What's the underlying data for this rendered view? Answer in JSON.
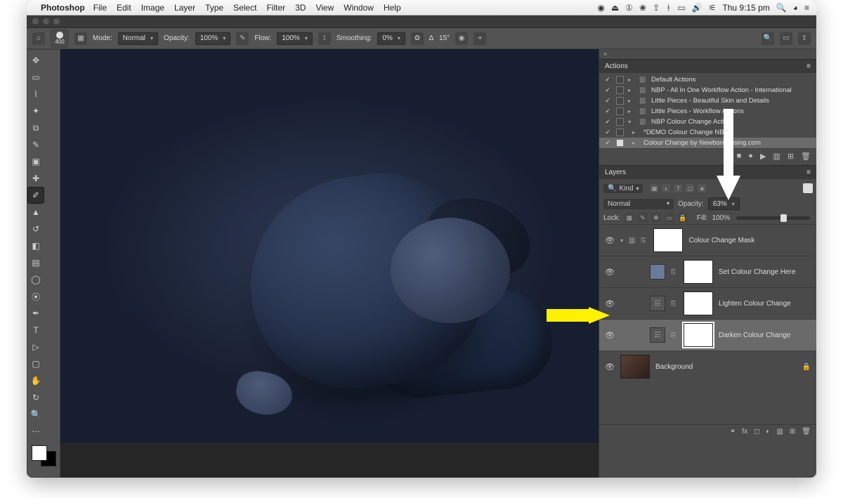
{
  "menubar": {
    "app": "Photoshop",
    "items": [
      "File",
      "Edit",
      "Image",
      "Layer",
      "Type",
      "Select",
      "Filter",
      "3D",
      "View",
      "Window",
      "Help"
    ],
    "clock": "Thu 9:15 pm"
  },
  "options": {
    "brush_size": "400",
    "mode_label": "Mode:",
    "mode_value": "Normal",
    "opacity_label": "Opacity:",
    "opacity_value": "100%",
    "flow_label": "Flow:",
    "flow_value": "100%",
    "smoothing_label": "Smoothing:",
    "smoothing_value": "0%",
    "angle_label": "∆",
    "angle_value": "15°"
  },
  "actions": {
    "title": "Actions",
    "items": [
      {
        "level": 0,
        "checked": true,
        "folder": true,
        "open": false,
        "label": "Default Actions"
      },
      {
        "level": 0,
        "checked": true,
        "folder": true,
        "open": false,
        "label": "NBP - All In One Workflow Action - International"
      },
      {
        "level": 0,
        "checked": true,
        "folder": true,
        "open": false,
        "label": "Little Pieces - Beautiful Skin and Details"
      },
      {
        "level": 0,
        "checked": true,
        "folder": true,
        "open": false,
        "label": "Little Pieces - Workflow Actions"
      },
      {
        "level": 0,
        "checked": true,
        "folder": true,
        "open": true,
        "label": "NBP Colour Change Action"
      },
      {
        "level": 1,
        "checked": true,
        "folder": false,
        "open": false,
        "label": "*DEMO Colour Change NBP"
      },
      {
        "level": 1,
        "checked": true,
        "folder": false,
        "open": false,
        "label": "Colour Change by NewbornPosing.com",
        "selected": true
      }
    ],
    "footer_icons": [
      "stop",
      "rec",
      "play",
      "folder",
      "new",
      "trash"
    ]
  },
  "layers": {
    "title": "Layers",
    "kind_label": "Kind",
    "blend_mode": "Normal",
    "opacity_label": "Opacity:",
    "opacity_value": "63%",
    "lock_label": "Lock:",
    "fill_label": "Fill:",
    "fill_value": "100%",
    "items": [
      {
        "type": "group",
        "name": "Colour Change Mask",
        "mask": true
      },
      {
        "type": "solid",
        "name": "Set Colour Change Here",
        "mask": true
      },
      {
        "type": "curves",
        "name": "Lighten Colour Change",
        "mask": true
      },
      {
        "type": "curves",
        "name": "Darken Colour Change",
        "mask": true,
        "selected": true
      },
      {
        "type": "bg",
        "name": "Background",
        "locked": true
      }
    ],
    "footer_icons": [
      "link",
      "fx",
      "mask",
      "adj",
      "group",
      "new",
      "trash"
    ]
  }
}
